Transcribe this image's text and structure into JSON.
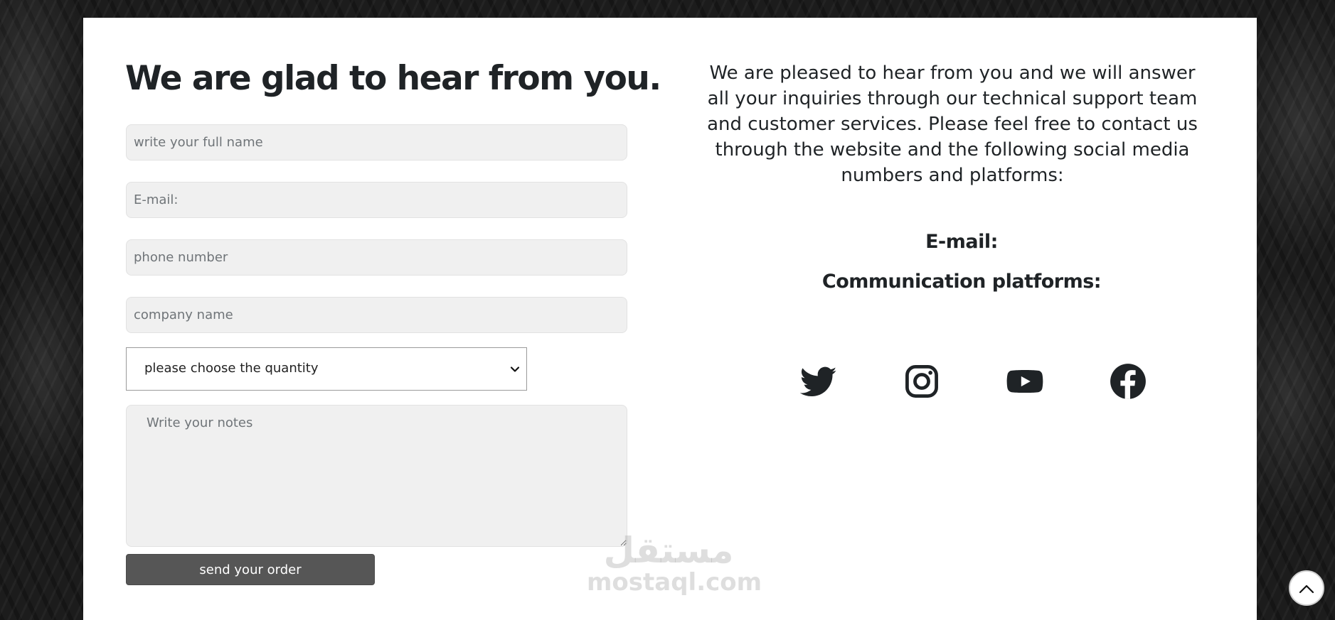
{
  "form": {
    "title": "We are glad to hear from you.",
    "full_name_placeholder": "write your full name",
    "email_placeholder": "E-mail:",
    "phone_placeholder": "phone number",
    "company_placeholder": "company name",
    "quantity_select": {
      "selected": "please choose the quantity"
    },
    "notes_placeholder": "Write your notes",
    "submit_label": "send your order"
  },
  "contact": {
    "intro": "We are pleased to hear from you and we will answer all your inquiries through our technical support team and customer services. Please feel free to contact us through the website and the following social media numbers and platforms:",
    "email_label": "E-mail:",
    "platforms_label": "Communication platforms:",
    "social_icons": [
      "twitter-icon",
      "instagram-icon",
      "youtube-icon",
      "facebook-icon"
    ]
  },
  "watermark": {
    "arabic": "مستقل",
    "latin": "mostaql.com"
  },
  "colors": {
    "text": "#1f2326",
    "field_background": "#f0f0f0",
    "button_background": "#565656",
    "card_background": "#ffffff"
  }
}
